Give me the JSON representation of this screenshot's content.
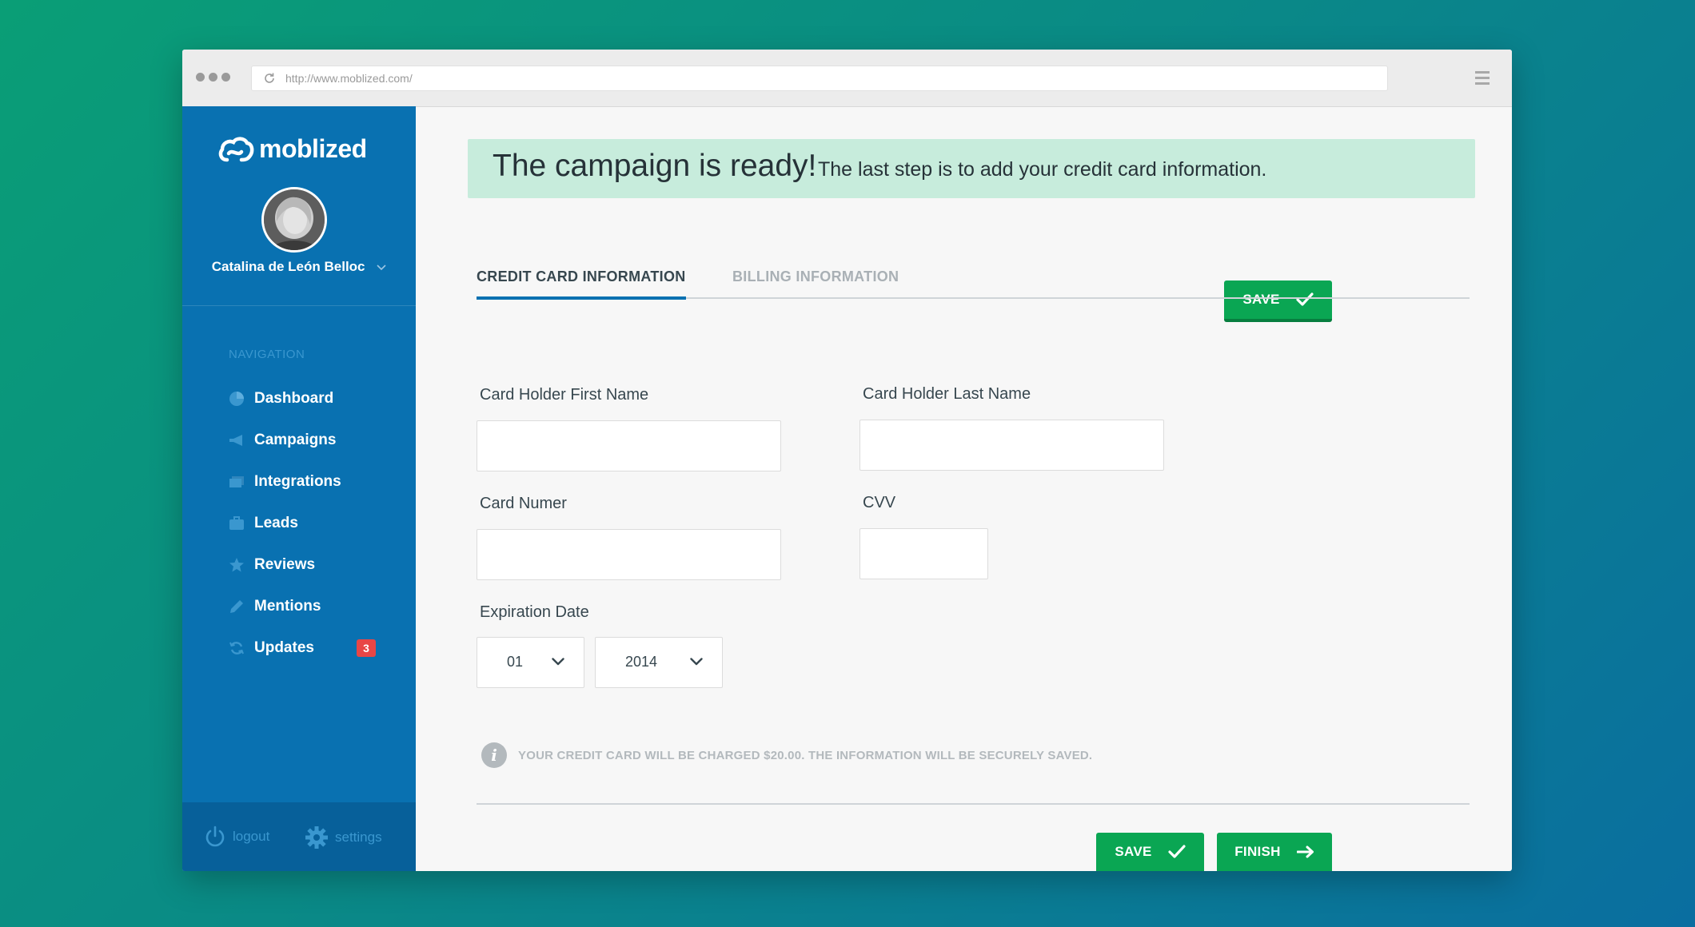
{
  "browser": {
    "url": "http://www.moblized.com/"
  },
  "sidebar": {
    "brand": "moblized",
    "user_name": "Catalina de León Belloc",
    "nav_heading": "NAVIGATION",
    "items": [
      {
        "label": "Dashboard",
        "icon": "pie-chart-icon"
      },
      {
        "label": "Campaigns",
        "icon": "megaphone-icon"
      },
      {
        "label": "Integrations",
        "icon": "layers-icon"
      },
      {
        "label": "Leads",
        "icon": "briefcase-icon"
      },
      {
        "label": "Reviews",
        "icon": "star-icon"
      },
      {
        "label": "Mentions",
        "icon": "pencil-icon"
      },
      {
        "label": "Updates",
        "icon": "refresh-icon",
        "badge": "3"
      }
    ],
    "footer": {
      "logout_label": "logout",
      "settings_label": "settings"
    }
  },
  "banner": {
    "title": "The campaign is ready!",
    "subtitle": "The last step is to add your credit card information."
  },
  "toolbar": {
    "save_label": "SAVE"
  },
  "tabs": [
    {
      "label": "CREDIT CARD INFORMATION",
      "active": true
    },
    {
      "label": "BILLING INFORMATION",
      "active": false
    }
  ],
  "form": {
    "first_name_label": "Card Holder First Name",
    "first_name_value": "",
    "last_name_label": "Card Holder Last Name",
    "last_name_value": "",
    "card_number_label": "Card Numer",
    "card_number_value": "",
    "cvv_label": "CVV",
    "cvv_value": "",
    "expiration_label": "Expiration Date",
    "exp_month": "01",
    "exp_year": "2014"
  },
  "info_text": "YOUR CREDIT CARD WILL BE CHARGED $20.00.  THE INFORMATION WILL BE SECURELY SAVED.",
  "footer_buttons": {
    "save_label": "SAVE",
    "finish_label": "FINISH"
  },
  "colors": {
    "sidebar": "#0971b1",
    "accent_green": "#0aa653",
    "banner_bg": "#c7ecdc",
    "badge": "#e84646"
  }
}
